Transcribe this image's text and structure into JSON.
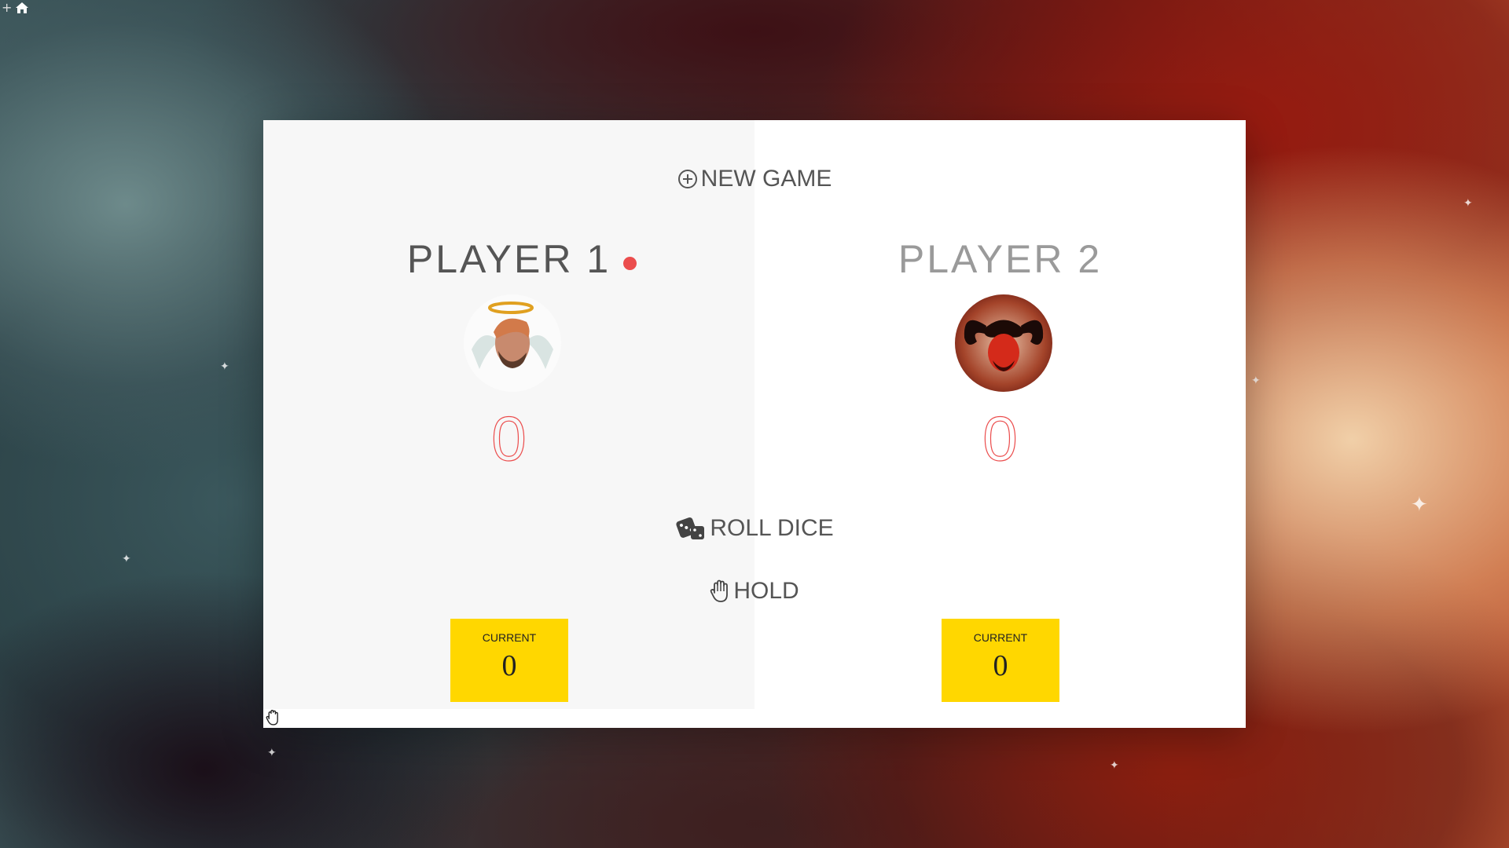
{
  "background": {
    "left_tone": "#3a5458",
    "right_tone": "#b5502f"
  },
  "corner": {
    "plus_symbol": "+",
    "home_icon": "home-icon"
  },
  "buttons": {
    "new_game": {
      "label": "NEW GAME",
      "icon": "plus-circle-icon"
    },
    "roll_dice": {
      "label": "ROLL DICE",
      "icon": "dice-icon"
    },
    "hold": {
      "label": "HOLD",
      "icon": "hand-icon"
    }
  },
  "players": [
    {
      "name": "PLAYER 1",
      "active": true,
      "score": "0",
      "current_label": "CURRENT",
      "current_score": "0",
      "avatar": "angel-avatar"
    },
    {
      "name": "PLAYER 2",
      "active": false,
      "score": "0",
      "current_label": "CURRENT",
      "current_score": "0",
      "avatar": "devil-avatar"
    }
  ],
  "colors": {
    "active_dot": "#eb4d4d",
    "score": "#eb4d4d",
    "current_box": "#ffd700",
    "active_panel": "#f7f7f7",
    "inactive_panel": "#ffffff"
  }
}
